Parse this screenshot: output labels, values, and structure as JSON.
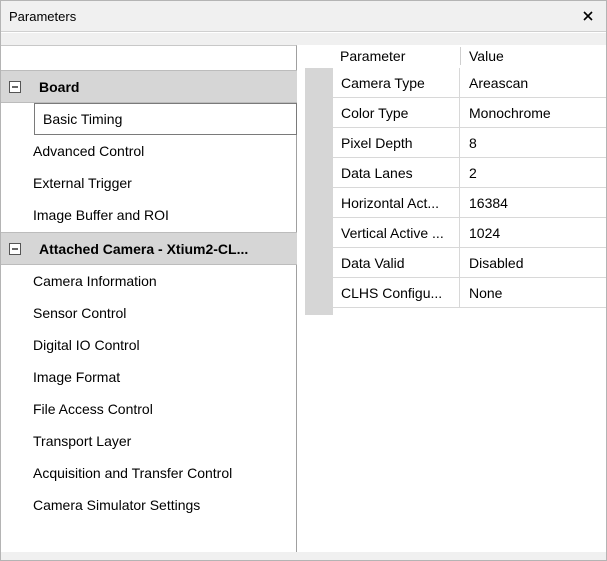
{
  "window": {
    "title": "Parameters",
    "close_icon": "close-icon"
  },
  "tree": {
    "groups": [
      {
        "label": "Board",
        "expanded": true,
        "items": [
          {
            "label": "Basic Timing",
            "selected": true
          },
          {
            "label": "Advanced Control"
          },
          {
            "label": "External Trigger"
          },
          {
            "label": "Image Buffer and ROI"
          }
        ]
      },
      {
        "label": "Attached Camera - Xtium2-CL...",
        "expanded": true,
        "items": [
          {
            "label": "Camera Information"
          },
          {
            "label": "Sensor Control"
          },
          {
            "label": "Digital IO Control"
          },
          {
            "label": "Image Format"
          },
          {
            "label": "File Access Control"
          },
          {
            "label": "Transport Layer"
          },
          {
            "label": "Acquisition and Transfer Control"
          },
          {
            "label": "Camera Simulator Settings"
          }
        ]
      }
    ]
  },
  "grid": {
    "header": {
      "parameter": "Parameter",
      "value": "Value"
    },
    "rows": [
      {
        "name": "Camera Type",
        "value": "Areascan"
      },
      {
        "name": "Color Type",
        "value": "Monochrome"
      },
      {
        "name": "Pixel Depth",
        "value": "8"
      },
      {
        "name": "Data Lanes",
        "value": "2"
      },
      {
        "name": "Horizontal Act...",
        "value": "16384"
      },
      {
        "name": "Vertical Active ...",
        "value": "1024"
      },
      {
        "name": "Data Valid",
        "value": "Disabled"
      },
      {
        "name": "CLHS Configu...",
        "value": "None"
      }
    ]
  }
}
